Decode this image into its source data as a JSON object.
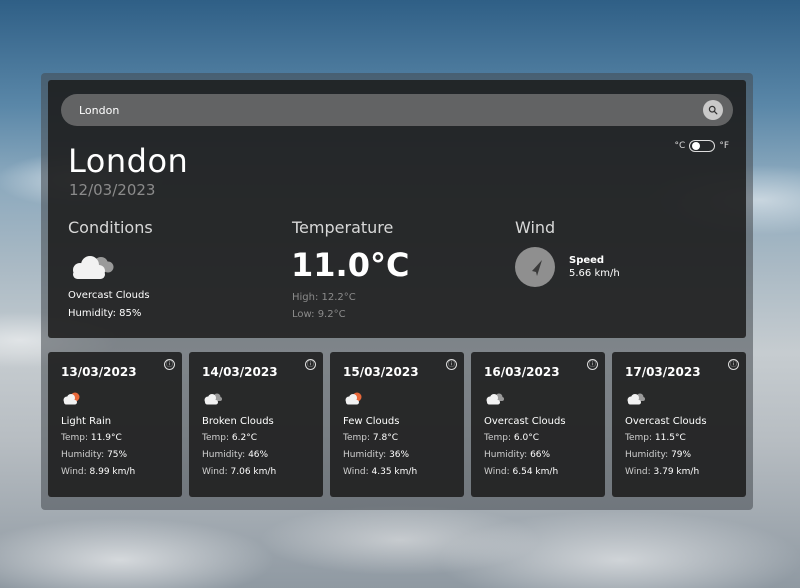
{
  "search": {
    "value": "London"
  },
  "units": {
    "celsius_label": "°C",
    "fahrenheit_label": "°F"
  },
  "current": {
    "city": "London",
    "date": "12/03/2023",
    "conditions": {
      "title": "Conditions",
      "icon": "overcast-clouds-icon",
      "description": "Overcast Clouds",
      "humidity": "Humidity: 85%"
    },
    "temperature": {
      "title": "Temperature",
      "value": "11.0°C",
      "high": "High: 12.2°C",
      "low": "Low: 9.2°C"
    },
    "wind": {
      "title": "Wind",
      "speed_label": "Speed",
      "speed_value": "5.66 km/h",
      "icon": "wind-direction-icon"
    }
  },
  "forecast": [
    {
      "date": "13/03/2023",
      "icon": "light-rain-icon",
      "description": "Light Rain",
      "temp_label": "Temp:",
      "temp": "11.9°C",
      "humidity_label": "Humidity:",
      "humidity": "75%",
      "wind_label": "Wind:",
      "wind": "8.99 km/h"
    },
    {
      "date": "14/03/2023",
      "icon": "broken-clouds-icon",
      "description": "Broken Clouds",
      "temp_label": "Temp:",
      "temp": "6.2°C",
      "humidity_label": "Humidity:",
      "humidity": "46%",
      "wind_label": "Wind:",
      "wind": "7.06 km/h"
    },
    {
      "date": "15/03/2023",
      "icon": "few-clouds-icon",
      "description": "Few Clouds",
      "temp_label": "Temp:",
      "temp": "7.8°C",
      "humidity_label": "Humidity:",
      "humidity": "36%",
      "wind_label": "Wind:",
      "wind": "4.35 km/h"
    },
    {
      "date": "16/03/2023",
      "icon": "overcast-clouds-icon",
      "description": "Overcast Clouds",
      "temp_label": "Temp:",
      "temp": "6.0°C",
      "humidity_label": "Humidity:",
      "humidity": "66%",
      "wind_label": "Wind:",
      "wind": "6.54 km/h"
    },
    {
      "date": "17/03/2023",
      "icon": "overcast-clouds-icon",
      "description": "Overcast Clouds",
      "temp_label": "Temp:",
      "temp": "11.5°C",
      "humidity_label": "Humidity:",
      "humidity": "79%",
      "wind_label": "Wind:",
      "wind": "3.79 km/h"
    }
  ],
  "info_icon": "ⓘ"
}
